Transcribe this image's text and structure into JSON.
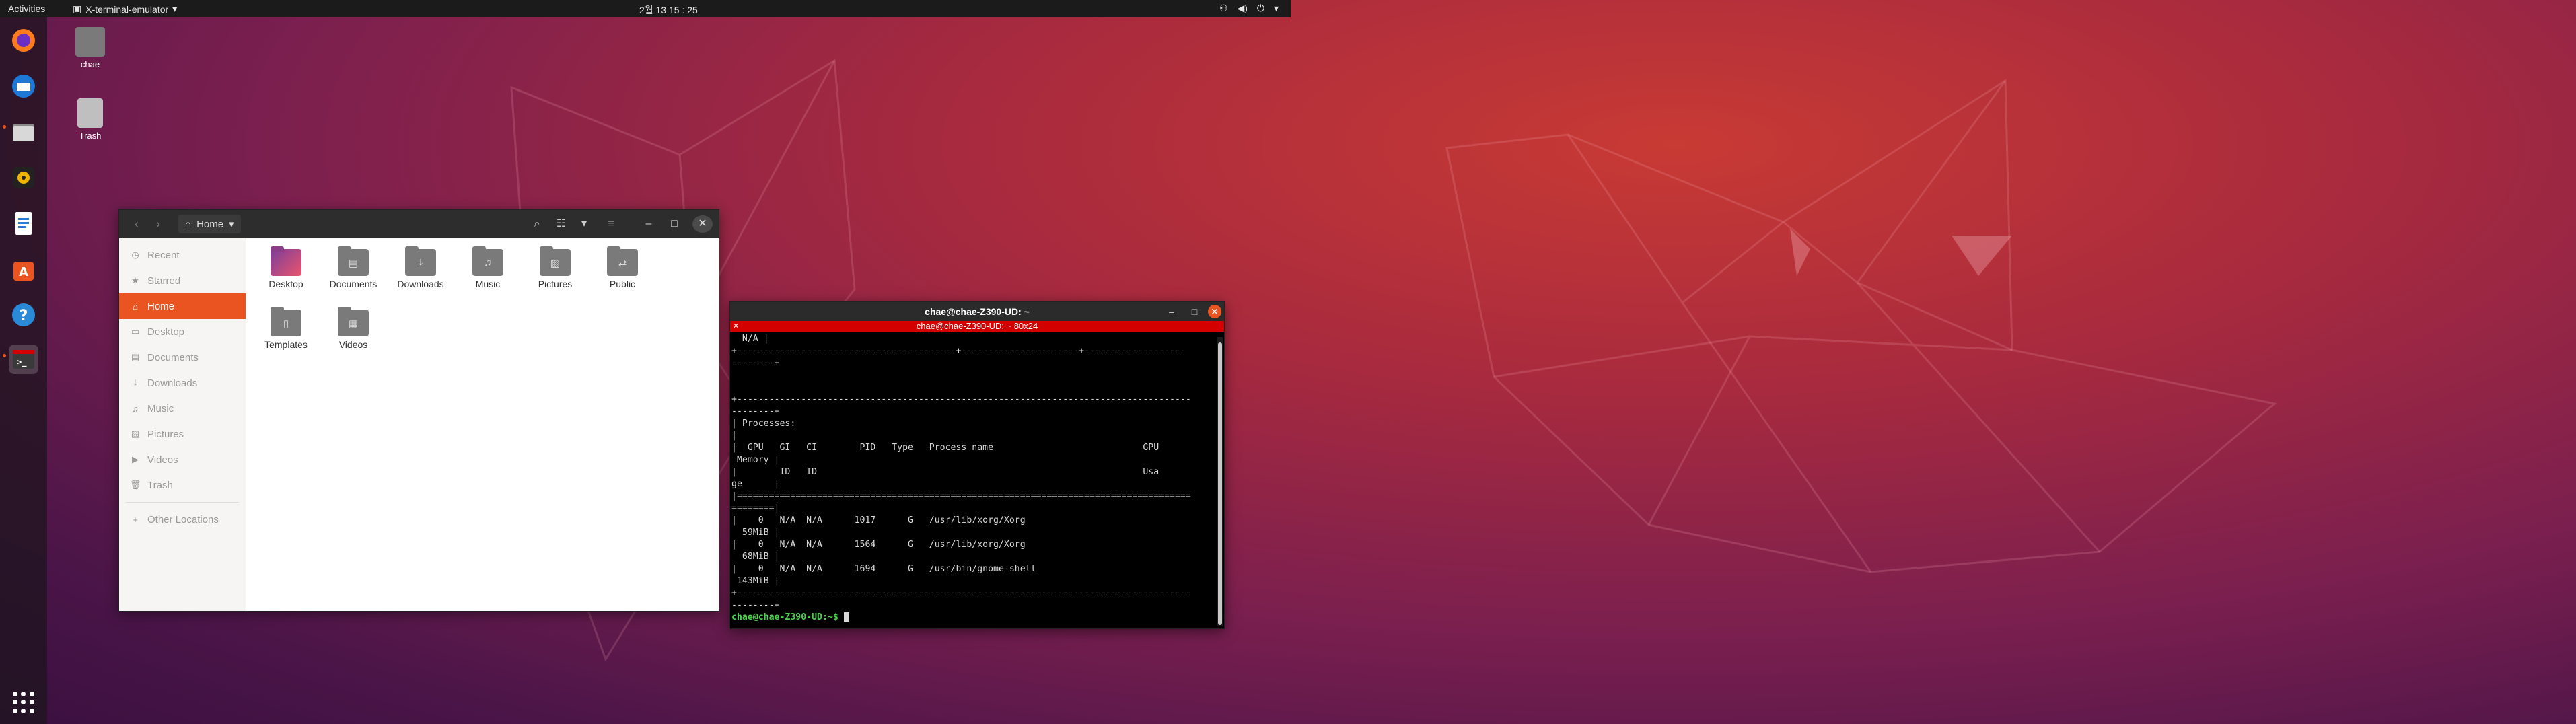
{
  "topbar": {
    "activities": "Activities",
    "app_menu": "X-terminal-emulator",
    "clock": "2월 13 15 : 25"
  },
  "desktop_icons": [
    {
      "label": "chae",
      "icon": "home-folder-icon"
    },
    {
      "label": "Trash",
      "icon": "trash-icon"
    }
  ],
  "dock": {
    "items": [
      "firefox-icon",
      "thunderbird-icon",
      "files-icon",
      "rhythmbox-icon",
      "writer-icon",
      "software-icon",
      "help-icon",
      "terminal-icon"
    ],
    "active": "terminal-icon"
  },
  "files": {
    "breadcrumb": "Home",
    "sidebar": [
      {
        "label": "Recent",
        "icon": "clock-icon"
      },
      {
        "label": "Starred",
        "icon": "star-icon"
      },
      {
        "label": "Home",
        "icon": "home-icon",
        "selected": true
      },
      {
        "label": "Desktop",
        "icon": "desktop-icon"
      },
      {
        "label": "Documents",
        "icon": "document-icon"
      },
      {
        "label": "Downloads",
        "icon": "download-icon"
      },
      {
        "label": "Music",
        "icon": "music-icon"
      },
      {
        "label": "Pictures",
        "icon": "picture-icon"
      },
      {
        "label": "Videos",
        "icon": "video-icon"
      },
      {
        "label": "Trash",
        "icon": "trash-icon"
      }
    ],
    "other_locations": "Other Locations",
    "folders": [
      "Desktop",
      "Documents",
      "Downloads",
      "Music",
      "Pictures",
      "Public",
      "Templates",
      "Videos"
    ]
  },
  "terminal": {
    "window_title": "chae@chae-Z390-UD: ~",
    "tab_title": "chae@chae-Z390-UD: ~ 80x24",
    "lines": [
      "  N/A |",
      "+-----------------------------------------+----------------------+-------------------",
      "--------+",
      "",
      "",
      "+-------------------------------------------------------------------------------------",
      "--------+",
      "| Processes:",
      "|",
      "|  GPU   GI   CI        PID   Type   Process name                            GPU",
      " Memory |",
      "|        ID   ID                                                             Usa",
      "ge      |",
      "|=====================================================================================",
      "========|",
      "|    0   N/A  N/A      1017      G   /usr/lib/xorg/Xorg",
      "  59MiB |",
      "|    0   N/A  N/A      1564      G   /usr/lib/xorg/Xorg",
      "  68MiB |",
      "|    0   N/A  N/A      1694      G   /usr/bin/gnome-shell",
      " 143MiB |",
      "+-------------------------------------------------------------------------------------",
      "--------+"
    ],
    "prompt": "chae@chae-Z390-UD:~$ "
  }
}
